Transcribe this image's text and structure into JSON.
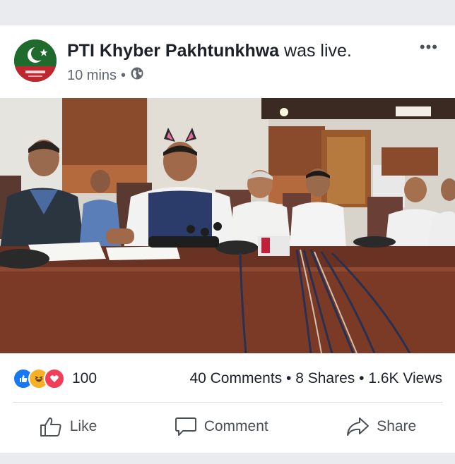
{
  "post": {
    "page_name": "PTI Khyber Pakhtunkhwa",
    "status_text": " was live.",
    "time": "10 mins",
    "separator": "•",
    "privacy_icon": "globe-icon",
    "more_icon": "more-options-icon",
    "more_label": "•••"
  },
  "stats": {
    "reaction_icons": [
      "like-icon",
      "haha-icon",
      "love-icon"
    ],
    "reaction_count": "100",
    "comments": "40 Comments",
    "shares": "8 Shares",
    "views": "1.6K Views",
    "separator": "•"
  },
  "actions": {
    "like": "Like",
    "comment": "Comment",
    "share": "Share"
  },
  "colors": {
    "like_blue": "#1877f2",
    "haha_yellow": "#f7b125",
    "love_red": "#f33e58",
    "text_dark": "#1d2129",
    "text_muted": "#616770"
  }
}
